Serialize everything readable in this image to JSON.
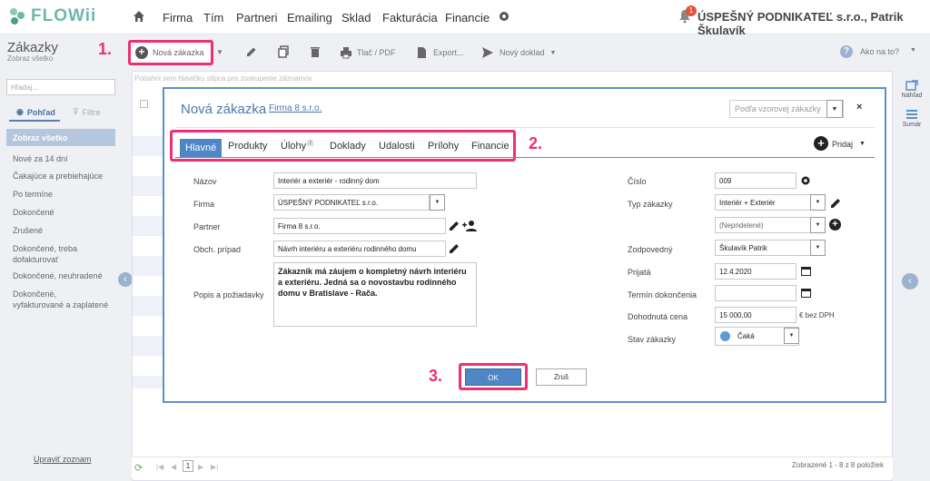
{
  "app": {
    "logo_text": "FLOWii",
    "brand_color": "#6fb7a9",
    "accent": "#4f86c6",
    "highlight": "#ee2f75"
  },
  "nav": {
    "items": [
      "Firma",
      "Tím",
      "Partneri",
      "Emailing",
      "Sklad",
      "Fakturácia",
      "Financie"
    ],
    "notification_count": "1",
    "company_user": "ÚSPEŠNÝ PODNIKATEĽ s.r.o., Patrik Škulavík"
  },
  "toolbar": {
    "title": "Zákazky",
    "subtitle": "Zobraz všetko",
    "new_label": "Nová zákazka",
    "print_label": "Tlač / PDF",
    "export_label": "Export...",
    "new_document_label": "Nový doklad",
    "help_label": "Ako na to?",
    "markers": [
      "1.",
      "2.",
      "3."
    ]
  },
  "sidebar": {
    "search_placeholder": "Hľadaj...",
    "tab_view": "Pohľad",
    "tab_filters": "Filtre",
    "items": [
      "Zobraz všetko",
      "Nové za 14 dní",
      "Čakajúce a prebiehajúce",
      "Po termíne",
      "Dokončené",
      "Zrušené",
      "Dokončené, treba dofakturovať",
      "Dokončené, neuhradené",
      "Dokončené, vyfakturované a zaplatené"
    ],
    "footer_link": "Upraviť zoznam"
  },
  "grid": {
    "group_hint": "Potiahni sem hlavičku stĺpca pre zoskupenie záznamov",
    "page": "1",
    "records": "Zobrazené 1 - 8 z 8 položiek"
  },
  "rail": {
    "preview": "Náhľad",
    "summary": "Sumár"
  },
  "dialog": {
    "title": "Nová zákazka",
    "firm_link": "Firma 8 s.r.o.",
    "template_placeholder": "Podľa vzorovej zákazky",
    "close": "×",
    "tabs": [
      {
        "label": "Hlavné",
        "count": ""
      },
      {
        "label": "Produkty",
        "count": ""
      },
      {
        "label": "Úlohy",
        "count": "7"
      },
      {
        "label": "Doklady",
        "count": ""
      },
      {
        "label": "Udalosti",
        "count": ""
      },
      {
        "label": "Prílohy",
        "count": ""
      },
      {
        "label": "Financie",
        "count": ""
      }
    ],
    "add_label": "Pridaj",
    "left": {
      "name_label": "Názov",
      "name_value": "Interiér a exteriér - rodinný dom",
      "firm_label": "Firma",
      "firm_value": "ÚSPEŠNÝ PODNIKATEĽ s.r.o.",
      "partner_label": "Partner",
      "partner_value": "Firma 8 s.r.o.",
      "case_label": "Obch. prípad",
      "case_value": "Návrh interiéru a exteriéru rodinného domu",
      "desc_label": "Popis a požiadavky",
      "desc_value": "Zákazník má záujem o kompletný návrh interiéru a exteriéru. Jedná sa o novostavbu rodinného domu v Bratislave - Rača."
    },
    "right": {
      "number_label": "Číslo",
      "number_value": "009",
      "type_label": "Typ zákazky",
      "type_value": "Interiér + Exteriér",
      "type2_value": "(Nepridelené)",
      "owner_label": "Zodpovedný",
      "owner_value": "Škulavík Patrik",
      "received_label": "Prijatá",
      "received_value": "12.4.2020",
      "deadline_label": "Termín dokončenia",
      "deadline_value": "",
      "price_label": "Dohodnutá cena",
      "price_value": "15 000,00",
      "price_unit": "€ bez DPH",
      "status_label": "Stav zákazky",
      "status_value": "Čaká"
    },
    "ok_label": "OK",
    "cancel_label": "Zruš"
  }
}
